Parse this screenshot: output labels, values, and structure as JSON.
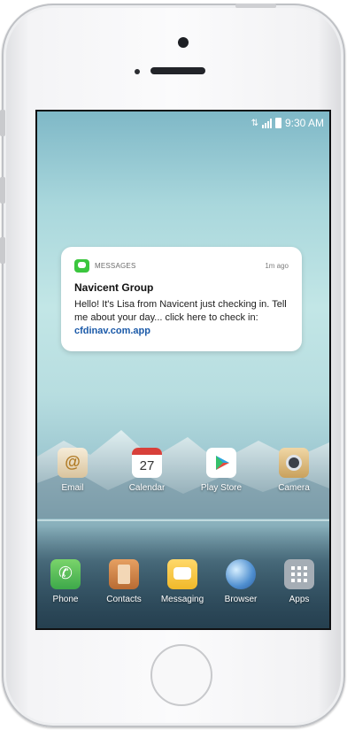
{
  "status_bar": {
    "time": "9:30 AM"
  },
  "notification": {
    "app_name": "MESSAGES",
    "time": "1m ago",
    "title": "Navicent Group",
    "body": "Hello! It's Lisa from Navicent just checking in. Tell me about your day... click here to check in: ",
    "link": "cfdinav.com.app"
  },
  "calendar_day": "27",
  "home_apps": [
    {
      "label": "Email",
      "icon": "email-icon"
    },
    {
      "label": "Calendar",
      "icon": "calendar-icon"
    },
    {
      "label": "Play Store",
      "icon": "play-store-icon"
    },
    {
      "label": "Camera",
      "icon": "camera-icon"
    }
  ],
  "dock_apps": [
    {
      "label": "Phone",
      "icon": "phone-icon"
    },
    {
      "label": "Contacts",
      "icon": "contacts-icon"
    },
    {
      "label": "Messaging",
      "icon": "messaging-icon"
    },
    {
      "label": "Browser",
      "icon": "browser-icon"
    },
    {
      "label": "Apps",
      "icon": "apps-grid-icon"
    }
  ],
  "colors": {
    "messages_green": "#3bc63e",
    "link_blue": "#1a59a8",
    "phone_body": "#f4f4f6"
  }
}
